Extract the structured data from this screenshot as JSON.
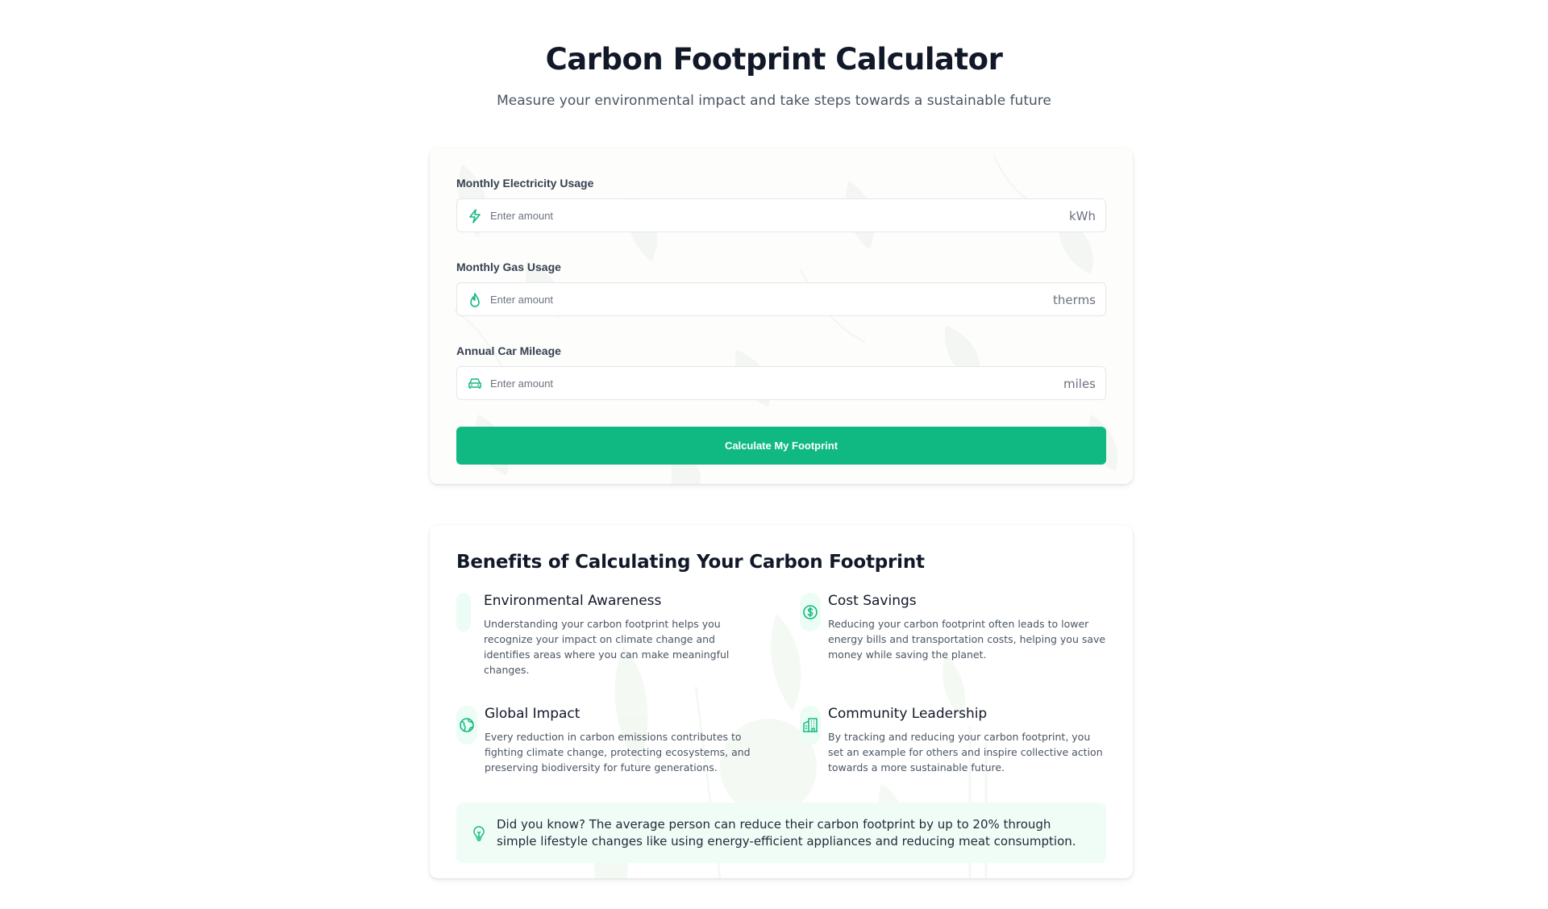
{
  "header": {
    "title": "Carbon Footprint Calculator",
    "subtitle": "Measure your environmental impact and take steps towards a sustainable future"
  },
  "calculator": {
    "fields": [
      {
        "label": "Monthly Electricity Usage",
        "placeholder": "Enter amount",
        "unit": "kWh",
        "icon": "lightning-bolt-icon"
      },
      {
        "label": "Monthly Gas Usage",
        "placeholder": "Enter amount",
        "unit": "therms",
        "icon": "flame-drop-icon"
      },
      {
        "label": "Annual Car Mileage",
        "placeholder": "Enter amount",
        "unit": "miles",
        "icon": "car-icon"
      }
    ],
    "button_label": "Calculate My Footprint"
  },
  "benefits": {
    "title": "Benefits of Calculating Your Carbon Footprint",
    "items": [
      {
        "title": "Environmental Awareness",
        "text": "Understanding your carbon footprint helps you recognize your impact on climate change and identifies areas where you can make meaningful changes.",
        "icon": "blank-icon"
      },
      {
        "title": "Cost Savings",
        "text": "Reducing your carbon footprint often leads to lower energy bills and transportation costs, helping you save money while saving the planet.",
        "icon": "dollar-icon"
      },
      {
        "title": "Global Impact",
        "text": "Every reduction in carbon emissions contributes to fighting climate change, protecting ecosystems, and preserving biodiversity for future generations.",
        "icon": "globe-icon"
      },
      {
        "title": "Community Leadership",
        "text": "By tracking and reducing your carbon footprint, you set an example for others and inspire collective action towards a more sustainable future.",
        "icon": "building-icon"
      }
    ],
    "tip": "Did you know? The average person can reduce their carbon footprint by up to 20% through simple lifestyle changes like using energy-efficient appliances and reducing meat consumption.",
    "tip_icon": "lightbulb-icon"
  },
  "colors": {
    "accent": "#10b981",
    "accent_light": "#ecfdf5",
    "text_dark": "#111827",
    "text_muted": "#4b5563"
  }
}
